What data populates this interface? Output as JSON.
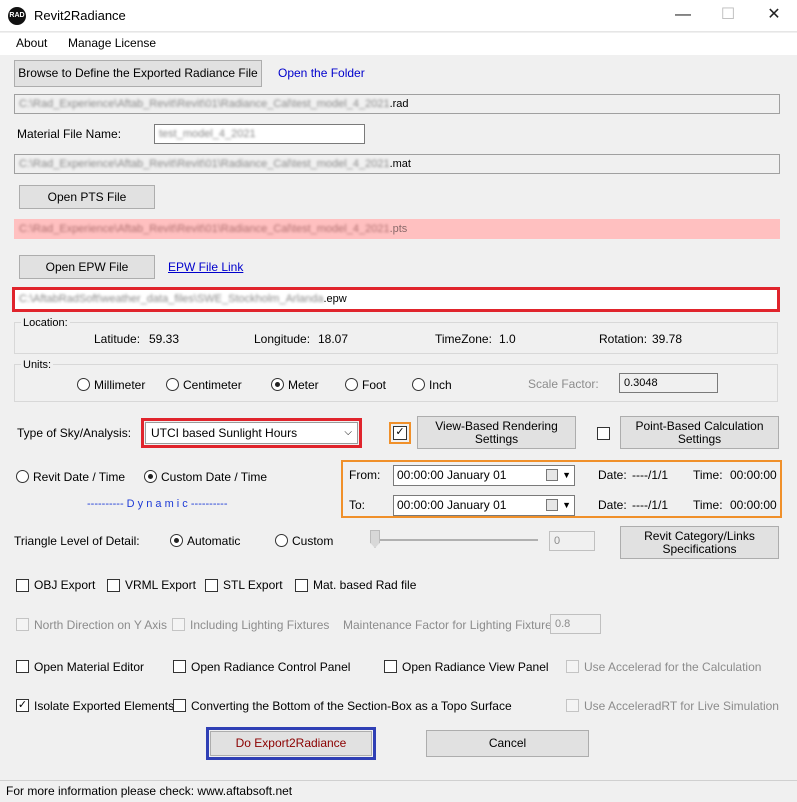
{
  "window": {
    "title": "Revit2Radiance",
    "icon": "app-logo-icon",
    "minimize": "—",
    "maximize": "☐",
    "close": "✕"
  },
  "menu": {
    "about": "About",
    "license": "Manage License"
  },
  "rad": {
    "browse_label": "Browse to Define the Exported Radiance File",
    "open_folder": "Open the Folder",
    "path_blurred": "C:\\Rad_Experience\\Aftab_Revit\\Revit\\01\\Radiance_Cal\\test_model_4_2021",
    "path_ext": ".rad"
  },
  "material": {
    "label": "Material File Name:",
    "value": "test_model_4_2021",
    "path_blurred": "C:\\Rad_Experience\\Aftab_Revit\\Revit\\01\\Radiance_Cal\\test_model_4_2021",
    "path_ext": ".mat"
  },
  "pts": {
    "button": "Open PTS File",
    "path_blurred": "C:\\Rad_Experience\\Aftab_Revit\\Revit\\01\\Radiance_Cal\\test_model_4_2021",
    "path_ext": ".pts"
  },
  "epw": {
    "button": "Open EPW File",
    "link": "EPW File Link",
    "path_blurred": "C:\\AftabRadSoft\\weather_data_files\\SWE_Stockholm_Arlanda",
    "path_ext": ".epw"
  },
  "location": {
    "group": "Location:",
    "lat_label": "Latitude:",
    "lat": "59.33",
    "lon_label": "Longitude:",
    "lon": "18.07",
    "tz_label": "TimeZone:",
    "tz": "1.0",
    "rot_label": "Rotation:",
    "rot": "39.78"
  },
  "units": {
    "group": "Units:",
    "mm": "Millimeter",
    "cm": "Centimeter",
    "m": "Meter",
    "ft": "Foot",
    "inch": "Inch",
    "scale_label": "Scale Factor:",
    "scale": "0.3048"
  },
  "sky": {
    "label": "Type of Sky/Analysis:",
    "value": "UTCI based Sunlight Hours",
    "view_btn": "View-Based Rendering Settings",
    "point_btn": "Point-Based Calculation Settings"
  },
  "date": {
    "revit": "Revit Date / Time",
    "custom": "Custom Date / Time",
    "dynamic": "---------- D y n a m i c ----------",
    "from_label": "From:",
    "to_label": "To:",
    "from_value": "00:00:00   January   01",
    "to_value": "00:00:00   January   01",
    "date_label": "Date:",
    "from_date": "----/1/1",
    "to_date": "----/1/1",
    "time_label": "Time:",
    "from_time": "00:00:00",
    "to_time": "00:00:00"
  },
  "triangle": {
    "label": "Triangle Level of Detail:",
    "auto": "Automatic",
    "custom": "Custom",
    "value": "0",
    "cat_btn": "Revit Category/Links Specifications"
  },
  "exports": {
    "obj": "OBJ Export",
    "vrml": "VRML Export",
    "stl": "STL Export",
    "mat": "Mat. based Rad file"
  },
  "opts": {
    "north": "North Direction on Y Axis",
    "lighting": "Including Lighting Fixtures",
    "maint_label": "Maintenance Factor for Lighting Fixtures:",
    "maint": "0.8"
  },
  "panels": {
    "mat_editor": "Open Material Editor",
    "control": "Open Radiance Control Panel",
    "view": "Open Radiance View Panel",
    "accel": "Use Accelerad for the Calculation"
  },
  "iso": {
    "isolate": "Isolate Exported Elements",
    "topo": "Converting the Bottom of the Section-Box as a Topo Surface",
    "accelrt": "Use AcceleradRT for Live Simulation"
  },
  "actions": {
    "export": "Do Export2Radiance",
    "cancel": "Cancel"
  },
  "status": {
    "text": "For more information please check: www.aftabsoft.net"
  },
  "colors": {
    "red_highlight": "#e0242c",
    "orange_highlight": "#f0902a",
    "blue_highlight": "#2f3fb5",
    "pts_error_bg": "#ffc0c0",
    "link": "#0000cc"
  }
}
